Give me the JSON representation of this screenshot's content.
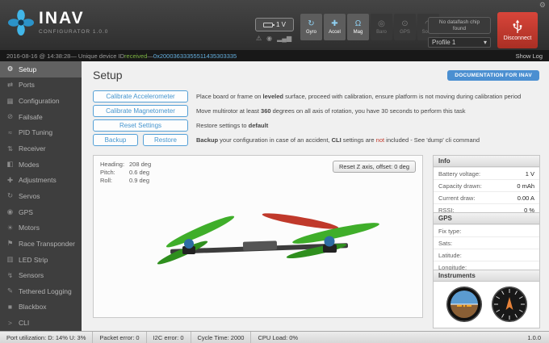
{
  "app": {
    "name": "INAV",
    "subtitle": "CONFIGURATOR 1.0.0",
    "gear_icon": "⚙"
  },
  "header": {
    "battery_voltage": "1 V",
    "warning_icon": "⚠",
    "link_icon": "◉",
    "signal_icon": "▂▄▆",
    "sensors": [
      {
        "label": "Gyro",
        "icon": "↻"
      },
      {
        "label": "Accel",
        "icon": "✚"
      },
      {
        "label": "Mag",
        "icon": "Ω"
      },
      {
        "label": "Baro",
        "icon": "◎"
      },
      {
        "label": "GPS",
        "icon": "⊙"
      },
      {
        "label": "Sonar",
        "icon": "◠"
      }
    ],
    "dataflash": "No dataflash chip found",
    "profile": "Profile 1",
    "profile_caret": "▾",
    "disconnect": "Disconnect"
  },
  "log_bar": {
    "timestamp": "2016-08-16 @ 14:38:28",
    "msg_pre": " — Unique device ID ",
    "received": "received",
    "sep": " — ",
    "device_id": "0x20003633355511435303335",
    "show_log": "Show Log"
  },
  "sidebar": {
    "items": [
      {
        "icon": "⚙",
        "label": "Setup"
      },
      {
        "icon": "⇄",
        "label": "Ports"
      },
      {
        "icon": "▦",
        "label": "Configuration"
      },
      {
        "icon": "⊘",
        "label": "Failsafe"
      },
      {
        "icon": "≈",
        "label": "PID Tuning"
      },
      {
        "icon": "⇅",
        "label": "Receiver"
      },
      {
        "icon": "◧",
        "label": "Modes"
      },
      {
        "icon": "✚",
        "label": "Adjustments"
      },
      {
        "icon": "↻",
        "label": "Servos"
      },
      {
        "icon": "◉",
        "label": "GPS"
      },
      {
        "icon": "☀",
        "label": "Motors"
      },
      {
        "icon": "⚑",
        "label": "Race Transponder"
      },
      {
        "icon": "▥",
        "label": "LED Strip"
      },
      {
        "icon": "↯",
        "label": "Sensors"
      },
      {
        "icon": "✎",
        "label": "Tethered Logging"
      },
      {
        "icon": "■",
        "label": "Blackbox"
      },
      {
        "icon": ">",
        "label": "CLI"
      }
    ]
  },
  "main": {
    "title": "Setup",
    "doc_button": "DOCUMENTATION FOR INAV",
    "rows": {
      "accel": {
        "button": "Calibrate Accelerometer",
        "pre": "Place board or frame on ",
        "bold": "leveled",
        "post": " surface, proceed with calibration, ensure platform is not moving during calibration period"
      },
      "mag": {
        "button": "Calibrate Magnetometer",
        "pre": "Move multirotor at least ",
        "bold": "360",
        "post": " degrees on all axis of rotation, you have 30 seconds to perform this task"
      },
      "reset": {
        "button": "Reset Settings",
        "pre": "Restore settings to ",
        "bold": "default",
        "post": ""
      },
      "backup": {
        "backup_button": "Backup",
        "restore_button": "Restore",
        "p1": "Backup",
        "p2": " your configuration in case of an accident, ",
        "p3": "CLI",
        "p4": " settings are ",
        "p5": "not",
        "p6": " included - See 'dump' cli command"
      }
    },
    "model_view": {
      "heading_label": "Heading:",
      "heading_value": "208 deg",
      "pitch_label": "Pitch:",
      "pitch_value": "0.6 deg",
      "roll_label": "Roll:",
      "roll_value": "0.9 deg",
      "reset_z_button": "Reset Z axis, offset: 0 deg"
    },
    "info_panel": {
      "title": "Info",
      "rows": [
        {
          "label": "Battery voltage:",
          "value": "1 V"
        },
        {
          "label": "Capacity drawn:",
          "value": "0 mAh"
        },
        {
          "label": "Current draw:",
          "value": "0.00 A"
        },
        {
          "label": "RSSI:",
          "value": "0 %"
        }
      ]
    },
    "gps_panel": {
      "title": "GPS",
      "rows": [
        {
          "label": "Fix type:",
          "value": ""
        },
        {
          "label": "Sats:",
          "value": ""
        },
        {
          "label": "Latitude:",
          "value": ""
        },
        {
          "label": "Longitude:",
          "value": ""
        }
      ]
    },
    "instruments_panel": {
      "title": "Instruments"
    }
  },
  "statusbar_bottom": {
    "port_utilization": "Port utilization: D: 14% U: 3%",
    "packet_error": "Packet error: 0",
    "i2c_error": "I2C error: 0",
    "cycle_time": "Cycle Time: 2000",
    "cpu_load": "CPU Load: 0%",
    "version": "1.0.0"
  }
}
